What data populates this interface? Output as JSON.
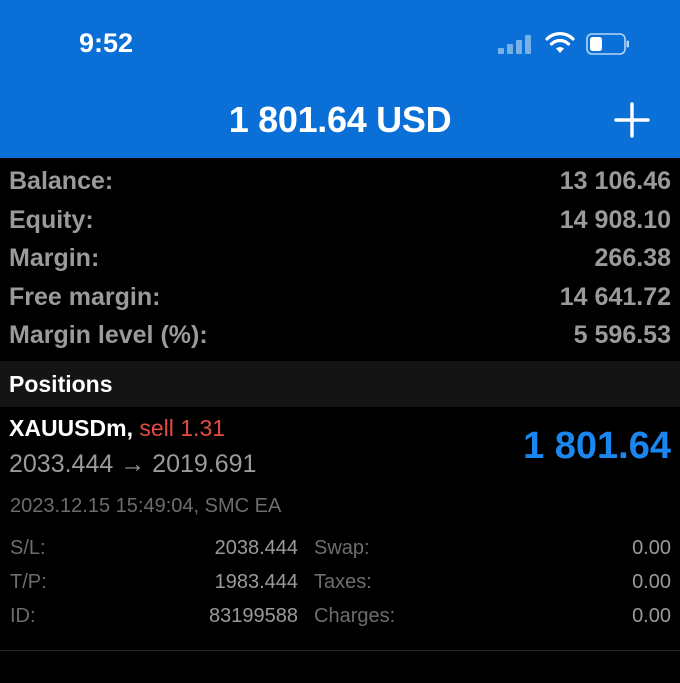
{
  "status_bar": {
    "time": "9:52"
  },
  "header": {
    "title": "1 801.64 USD",
    "add_icon": "plus-icon"
  },
  "summary": [
    {
      "label": "Balance:",
      "value": "13 106.46"
    },
    {
      "label": "Equity:",
      "value": "14 908.10"
    },
    {
      "label": "Margin:",
      "value": "266.38"
    },
    {
      "label": "Free margin:",
      "value": "14 641.72"
    },
    {
      "label": "Margin level (%):",
      "value": "5 596.53"
    }
  ],
  "positions": {
    "header": "Positions",
    "items": [
      {
        "symbol": "XAUUSDm,",
        "side": "sell 1.31",
        "prices": "2033.444 → 2019.691",
        "profit": "1 801.64",
        "datetime": "2023.12.15 15:49:04, SMC EA",
        "sl_label": "S/L:",
        "sl_value": "2038.444",
        "tp_label": "T/P:",
        "tp_value": "1983.444",
        "id_label": "ID:",
        "id_value": "83199588",
        "swap_label": "Swap:",
        "swap_value": "0.00",
        "taxes_label": "Taxes:",
        "taxes_value": "0.00",
        "charges_label": "Charges:",
        "charges_value": "0.00"
      }
    ]
  },
  "colors": {
    "header_bg": "#0a6fd6",
    "profit": "#1a86f0",
    "sell": "#e24b43"
  }
}
